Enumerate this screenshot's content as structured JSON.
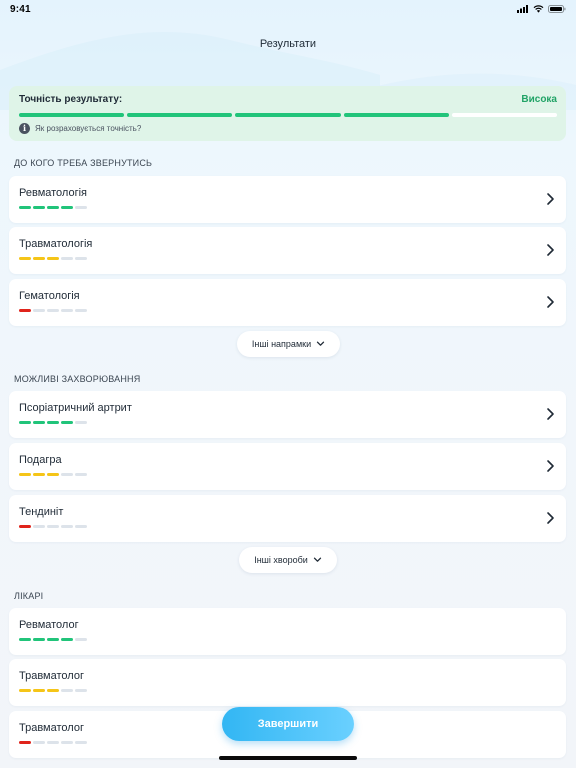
{
  "status_bar": {
    "time": "9:41"
  },
  "header": {
    "title": "Результати"
  },
  "accuracy": {
    "label": "Точність результату:",
    "value": "Висока",
    "filled_segments": 4,
    "total_segments": 5,
    "info_text": "Як розраховується точність?",
    "color": "#21c47a"
  },
  "sections": {
    "directions": {
      "title": "ДО КОГО ТРЕБА ЗВЕРНУТИСЬ",
      "items": [
        {
          "label": "Ревматологія",
          "level": 4,
          "color": "#21c47a"
        },
        {
          "label": "Травматологія",
          "level": 3,
          "color": "#f5c518"
        },
        {
          "label": "Гематологія",
          "level": 1,
          "color": "#e0241b"
        }
      ],
      "more_label": "Інші напрамки"
    },
    "diseases": {
      "title": "МОЖЛИВІ ЗАХВОРЮВАННЯ",
      "items": [
        {
          "label": "Псоріатричний артрит",
          "level": 4,
          "color": "#21c47a"
        },
        {
          "label": "Подагра",
          "level": 3,
          "color": "#f5c518"
        },
        {
          "label": "Тендиніт",
          "level": 1,
          "color": "#e0241b"
        }
      ],
      "more_label": "Інші хвороби"
    },
    "doctors": {
      "title": "ЛІКАРІ",
      "items": [
        {
          "label": "Ревматолог",
          "level": 4,
          "color": "#21c47a"
        },
        {
          "label": "Травматолог",
          "level": 3,
          "color": "#f5c518"
        },
        {
          "label": "Травматолог",
          "level": 1,
          "color": "#e0241b"
        }
      ]
    }
  },
  "level_max": 5,
  "finish_label": "Завершити"
}
